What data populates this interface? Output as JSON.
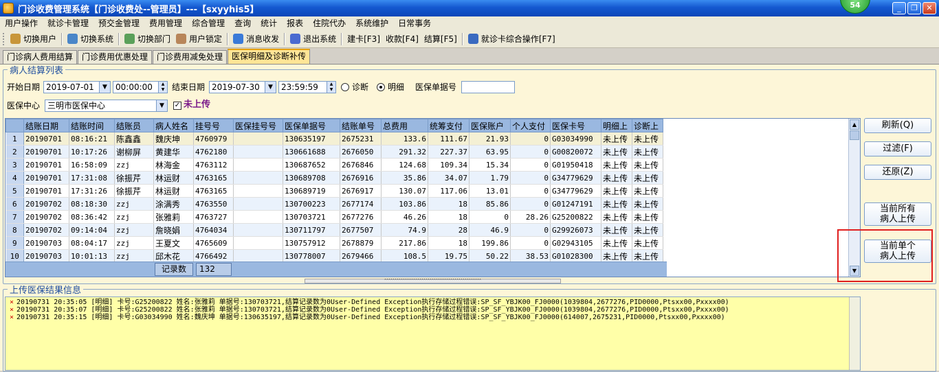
{
  "window": {
    "title": "门诊收费管理系统【门诊收费处--管理员】---【sxyyhis5】",
    "badge": "54"
  },
  "menu": [
    "用户操作",
    "就诊卡管理",
    "预交金管理",
    "费用管理",
    "综合管理",
    "查询",
    "统计",
    "报表",
    "住院代办",
    "系统维护",
    "日常事务"
  ],
  "toolbar": [
    {
      "label": "切换用户",
      "icon": "switch-user-icon",
      "color": "#c8963a"
    },
    {
      "label": "切换系统",
      "icon": "switch-system-icon",
      "color": "#4a86c8"
    },
    {
      "label": "切换部门",
      "icon": "switch-dept-icon",
      "color": "#5aa05a"
    },
    {
      "label": "用户锁定",
      "icon": "lock-user-icon",
      "color": "#b8865a"
    },
    {
      "label": "消息收发",
      "icon": "message-icon",
      "color": "#3a7ad8"
    },
    {
      "label": "退出系统",
      "icon": "exit-icon",
      "color": "#4a6ad0"
    },
    {
      "label": "建卡[F3]",
      "icon": "",
      "color": ""
    },
    {
      "label": "收款[F4]",
      "icon": "",
      "color": ""
    },
    {
      "label": "结算[F5]",
      "icon": "",
      "color": ""
    },
    {
      "label": "就诊卡综合操作[F7]",
      "icon": "card-icon",
      "color": "#3a6ac0"
    }
  ],
  "tabs": [
    "门诊病人费用结算",
    "门诊费用优惠处理",
    "门诊费用减免处理",
    "医保明细及诊断补传"
  ],
  "filters": {
    "group_title": "病人结算列表",
    "start_date_label": "开始日期",
    "start_date": "2019-07-01",
    "start_time": "00:00:00",
    "end_date_label": "结束日期",
    "end_date": "2019-07-30",
    "end_time": "23:59:59",
    "radio_diag": "诊断",
    "radio_detail": "明细",
    "bill_no_label": "医保单据号",
    "bill_no": "",
    "center_label": "医保中心",
    "center": "三明市医保中心",
    "not_uploaded": "未上传"
  },
  "table": {
    "columns": [
      "",
      "结账日期",
      "结账时间",
      "结账员",
      "病人姓名",
      "挂号号",
      "医保挂号号",
      "医保单据号",
      "结账单号",
      "总费用",
      "统筹支付",
      "医保账户",
      "个人支付",
      "医保卡号",
      "明细上",
      "诊断上"
    ],
    "rows": [
      [
        "1",
        "20190701",
        "08:16:21",
        "陈鑫鑫",
        "魏庆坤",
        "4760979",
        "",
        "130635197",
        "2675231",
        "133.6",
        "111.67",
        "21.93",
        "0",
        "G03034990",
        "未上传",
        "未上传"
      ],
      [
        "2",
        "20190701",
        "10:17:26",
        "谢柳屏",
        "黄建华",
        "4762180",
        "",
        "130661688",
        "2676050",
        "291.32",
        "227.37",
        "63.95",
        "0",
        "G00820072",
        "未上传",
        "未上传"
      ],
      [
        "3",
        "20190701",
        "16:58:09",
        "zzj",
        "林海金",
        "4763112",
        "",
        "130687652",
        "2676846",
        "124.68",
        "109.34",
        "15.34",
        "0",
        "G01950418",
        "未上传",
        "未上传"
      ],
      [
        "4",
        "20190701",
        "17:31:08",
        "徐振芹",
        "林运财",
        "4763165",
        "",
        "130689708",
        "2676916",
        "35.86",
        "34.07",
        "1.79",
        "0",
        "G34779629",
        "未上传",
        "未上传"
      ],
      [
        "5",
        "20190701",
        "17:31:26",
        "徐振芹",
        "林运财",
        "4763165",
        "",
        "130689719",
        "2676917",
        "130.07",
        "117.06",
        "13.01",
        "0",
        "G34779629",
        "未上传",
        "未上传"
      ],
      [
        "6",
        "20190702",
        "08:18:30",
        "zzj",
        "涂满秀",
        "4763550",
        "",
        "130700223",
        "2677174",
        "103.86",
        "18",
        "85.86",
        "0",
        "G01247191",
        "未上传",
        "未上传"
      ],
      [
        "7",
        "20190702",
        "08:36:42",
        "zzj",
        "张雅莉",
        "4763727",
        "",
        "130703721",
        "2677276",
        "46.26",
        "18",
        "0",
        "28.26",
        "G25200822",
        "未上传",
        "未上传"
      ],
      [
        "8",
        "20190702",
        "09:14:04",
        "zzj",
        "詹晓娟",
        "4764034",
        "",
        "130711797",
        "2677507",
        "74.9",
        "28",
        "46.9",
        "0",
        "G29926073",
        "未上传",
        "未上传"
      ],
      [
        "9",
        "20190703",
        "08:04:17",
        "zzj",
        "王夏文",
        "4765609",
        "",
        "130757912",
        "2678879",
        "217.86",
        "18",
        "199.86",
        "0",
        "G02943105",
        "未上传",
        "未上传"
      ],
      [
        "10",
        "20190703",
        "10:01:13",
        "zzj",
        "邱木花",
        "4766492",
        "",
        "130778007",
        "2679466",
        "108.5",
        "19.75",
        "50.22",
        "38.53",
        "G01028300",
        "未上传",
        "未上传"
      ]
    ],
    "footer_label": "记录数",
    "footer_count": "132"
  },
  "side_buttons": {
    "refresh": "刷新(Q)",
    "filter": "过滤(F)",
    "restore": "还原(Z)",
    "upload_all": "当前所有\n病人上传",
    "upload_one": "当前单个\n病人上传"
  },
  "log": {
    "title": "上传医保结果信息",
    "lines": [
      "20190731 20:35:05 [明细] 卡号:G25200822 姓名:张雅莉 单据号:130703721,结算记录数为0User-Defined Exception执行存储过程错误:SP_SF_YBJK00_FJ0000(1039804,2677276,PID0000,Ptsxx00,Pxxxx00)",
      "20190731 20:35:07 [明细] 卡号:G25200822 姓名:张雅莉 单据号:130703721,结算记录数为0User-Defined Exception执行存储过程错误:SP_SF_YBJK00_FJ0000(1039804,2677276,PID0000,Ptsxx00,Pxxxx00)",
      "20190731 20:35:15 [明细] 卡号:G03034990 姓名:魏庆坤 单据号:130635197,结算记录数为0User-Defined Exception执行存储过程错误:SP_SF_YBJK00_FJ0000(614007,2675231,PID0000,Ptsxx00,Pxxxx00)"
    ]
  }
}
